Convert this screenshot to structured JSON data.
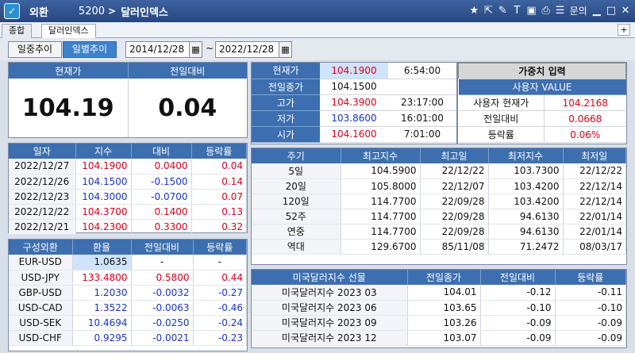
{
  "titlebar": {
    "category": "외환",
    "code": "5200",
    "title": "달러인덱스",
    "menu_label": "문의"
  },
  "tabs": [
    "종합",
    "달러인덱스"
  ],
  "toolbar": {
    "daily": "일중추이",
    "period": "일별추이",
    "from": "2014/12/28",
    "to": "2022/12/28",
    "sep": "~"
  },
  "current": {
    "label_price": "현재가",
    "label_change": "전일대비",
    "price": "104.19",
    "change": "0.04"
  },
  "history": {
    "headers": [
      "일자",
      "지수",
      "대비",
      "등락률"
    ],
    "rows": [
      [
        "2022/12/27",
        "104.1900",
        "0.0400",
        "0.04"
      ],
      [
        "2022/12/26",
        "104.1500",
        "-0.1500",
        "0.14"
      ],
      [
        "2022/12/23",
        "104.3000",
        "-0.0700",
        "0.07"
      ],
      [
        "2022/12/22",
        "104.3700",
        "0.1400",
        "0.13"
      ],
      [
        "2022/12/21",
        "104.2300",
        "0.3300",
        "0.32"
      ]
    ]
  },
  "fx": {
    "headers": [
      "구성외환",
      "환율",
      "전일대비",
      "등락률"
    ],
    "rows": [
      [
        "EUR-USD",
        "1.0635",
        "-",
        "-"
      ],
      [
        "USD-JPY",
        "133.4800",
        "0.5800",
        "0.44"
      ],
      [
        "GBP-USD",
        "1.2030",
        "-0.0032",
        "-0.27"
      ],
      [
        "USD-CAD",
        "1.3522",
        "-0.0063",
        "-0.46"
      ],
      [
        "USD-SEK",
        "10.4694",
        "-0.0250",
        "-0.24"
      ],
      [
        "USD-CHF",
        "0.9295",
        "-0.0021",
        "-0.23"
      ]
    ]
  },
  "quote": {
    "rows": [
      {
        "label": "현재가",
        "value": "104.1900",
        "time": "6:54:00"
      },
      {
        "label": "전일종가",
        "value": "104.1500",
        "time": ""
      },
      {
        "label": "고가",
        "value": "104.3900",
        "time": "23:17:00"
      },
      {
        "label": "저가",
        "value": "103.8600",
        "time": "16:01:00"
      },
      {
        "label": "시가",
        "value": "104.1600",
        "time": "7:01:00"
      }
    ]
  },
  "weighted": {
    "button": "가중치 입력",
    "header": "사용자 VALUE",
    "rows": [
      {
        "label": "사용자 현재가",
        "value": "104.2168"
      },
      {
        "label": "전일대비",
        "value": "0.0668"
      },
      {
        "label": "등락률",
        "value": "0.06%"
      }
    ]
  },
  "periods": {
    "headers": [
      "주기",
      "최고지수",
      "최고일",
      "최저지수",
      "최저일"
    ],
    "rows": [
      [
        "5일",
        "104.5900",
        "22/12/22",
        "103.7300",
        "22/12/22"
      ],
      [
        "20일",
        "105.8000",
        "22/12/07",
        "103.4200",
        "22/12/14"
      ],
      [
        "120일",
        "114.7700",
        "22/09/28",
        "103.4200",
        "22/12/14"
      ],
      [
        "52주",
        "114.7700",
        "22/09/28",
        "94.6130",
        "22/01/14"
      ],
      [
        "연중",
        "114.7700",
        "22/09/28",
        "94.6130",
        "22/01/14"
      ],
      [
        "역대",
        "129.6700",
        "85/11/08",
        "71.2472",
        "08/03/17"
      ]
    ]
  },
  "futures": {
    "headers": [
      "미국달러지수 선물",
      "전일종가",
      "전일대비",
      "등락률"
    ],
    "rows": [
      [
        "미국달러지수 2023 03",
        "104.01",
        "-0.12",
        "-0.11"
      ],
      [
        "미국달러지수 2023 06",
        "103.65",
        "-0.10",
        "-0.10"
      ],
      [
        "미국달러지수 2023 09",
        "103.26",
        "-0.09",
        "-0.09"
      ],
      [
        "미국달러지수 2023 12",
        "103.07",
        "-0.09",
        "-0.09"
      ]
    ]
  },
  "colors": {
    "up": "#d9001b",
    "down": "#1a33c8",
    "header": "#3d6fb0"
  }
}
